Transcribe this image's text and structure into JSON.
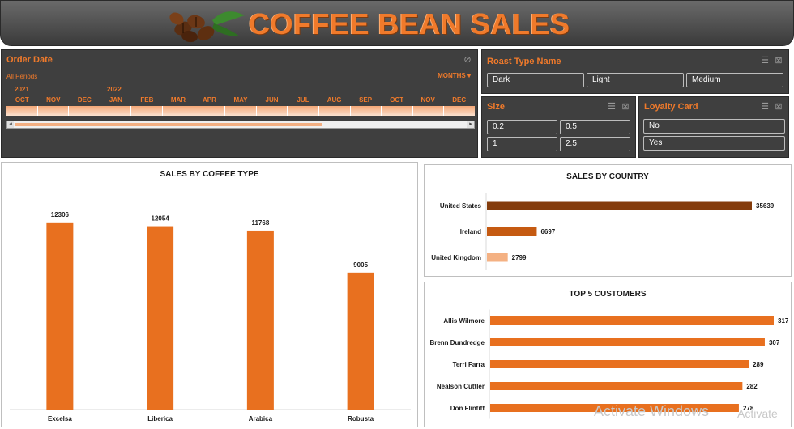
{
  "header": {
    "title": "COFFEE BEAN SALES",
    "image": "coffee-beans-logo"
  },
  "timeline": {
    "title": "Order Date",
    "all_periods": "All Periods",
    "granularity": "MONTHS",
    "years": [
      "2021",
      "2022"
    ],
    "months": [
      "OCT",
      "NOV",
      "DEC",
      "JAN",
      "FEB",
      "MAR",
      "APR",
      "MAY",
      "JUN",
      "JUL",
      "AUG",
      "SEP",
      "OCT",
      "NOV",
      "DEC"
    ]
  },
  "roast_slicer": {
    "title": "Roast Type Name",
    "items": [
      "Dark",
      "Light",
      "Medium"
    ]
  },
  "size_slicer": {
    "title": "Size",
    "items": [
      "0.2",
      "0.5",
      "1",
      "2.5"
    ]
  },
  "loyalty_slicer": {
    "title": "Loyalty Card",
    "items": [
      "No",
      "Yes"
    ]
  },
  "colors": {
    "accent": "#f07a2b",
    "panel": "#3f3f3f",
    "bar": "#e8701f",
    "bar_dark": "#843c0c",
    "bar_mid": "#c55a11",
    "bar_light": "#f4b183"
  },
  "watermark": {
    "text": "Activate Windows",
    "text2": "Activate"
  },
  "chart_data": [
    {
      "type": "bar",
      "title": "SALES BY COFFEE TYPE",
      "categories": [
        "Excelsa",
        "Liberica",
        "Arabica",
        "Robusta"
      ],
      "values": [
        12306,
        12054,
        11768,
        9005
      ],
      "ylim": [
        0,
        14000
      ]
    },
    {
      "type": "bar",
      "orientation": "horizontal",
      "title": "SALES BY COUNTRY",
      "categories": [
        "United States",
        "Ireland",
        "United Kingdom"
      ],
      "values": [
        35639,
        6697,
        2799
      ]
    },
    {
      "type": "bar",
      "orientation": "horizontal",
      "title": "TOP 5 CUSTOMERS",
      "categories": [
        "Allis Wilmore",
        "Brenn Dundredge",
        "Terri Farra",
        "Nealson Cuttler",
        "Don Flintiff"
      ],
      "values": [
        317,
        307,
        289,
        282,
        278
      ]
    }
  ]
}
